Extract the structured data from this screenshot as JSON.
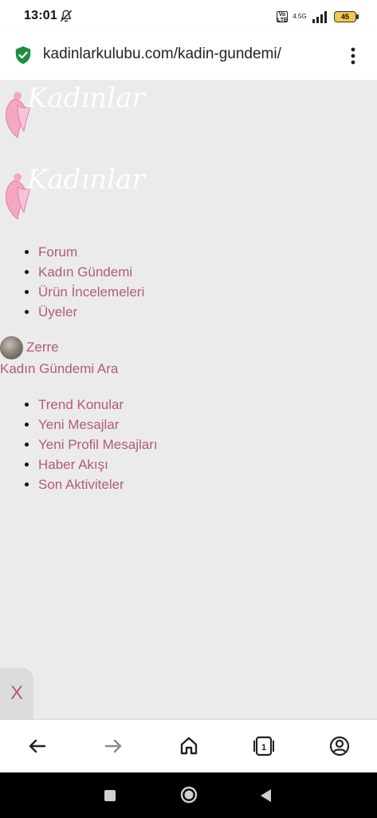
{
  "status_bar": {
    "time": "13:01",
    "volte_label": "Vo LTE",
    "network_gen": "4.5G",
    "battery": "45"
  },
  "url_bar": {
    "url": "kadinlarkulubu.com/kadin-gundemi/"
  },
  "logo": {
    "text": "Kadınlar Kulübü"
  },
  "nav": {
    "items": [
      {
        "label": "Forum"
      },
      {
        "label": "Kadın Gündemi"
      },
      {
        "label": "Ürün İncelemeleri"
      },
      {
        "label": "Üyeler"
      }
    ]
  },
  "user": {
    "name": "Zerre"
  },
  "search": {
    "title": "Kadın Gündemi Ara"
  },
  "sub_nav": {
    "items": [
      {
        "label": "Trend Konular"
      },
      {
        "label": "Yeni Mesajlar"
      },
      {
        "label": "Yeni Profil Mesajları"
      },
      {
        "label": "Haber Akışı"
      },
      {
        "label": "Son Aktiviteler"
      }
    ]
  },
  "close_tab": {
    "label": "X"
  },
  "toolbar": {
    "tabs_count": "1"
  },
  "colors": {
    "link": "#b05c78",
    "background": "#ebebeb",
    "secure_icon": "#1e8e3e",
    "battery": "#f2c94c"
  },
  "icons": {
    "secure": "shield-check-icon",
    "menu": "kebab-menu-icon",
    "back": "arrow-left-icon",
    "forward": "arrow-right-icon",
    "home": "home-icon",
    "tabs": "tab-switcher-icon",
    "account": "account-circle-icon"
  }
}
